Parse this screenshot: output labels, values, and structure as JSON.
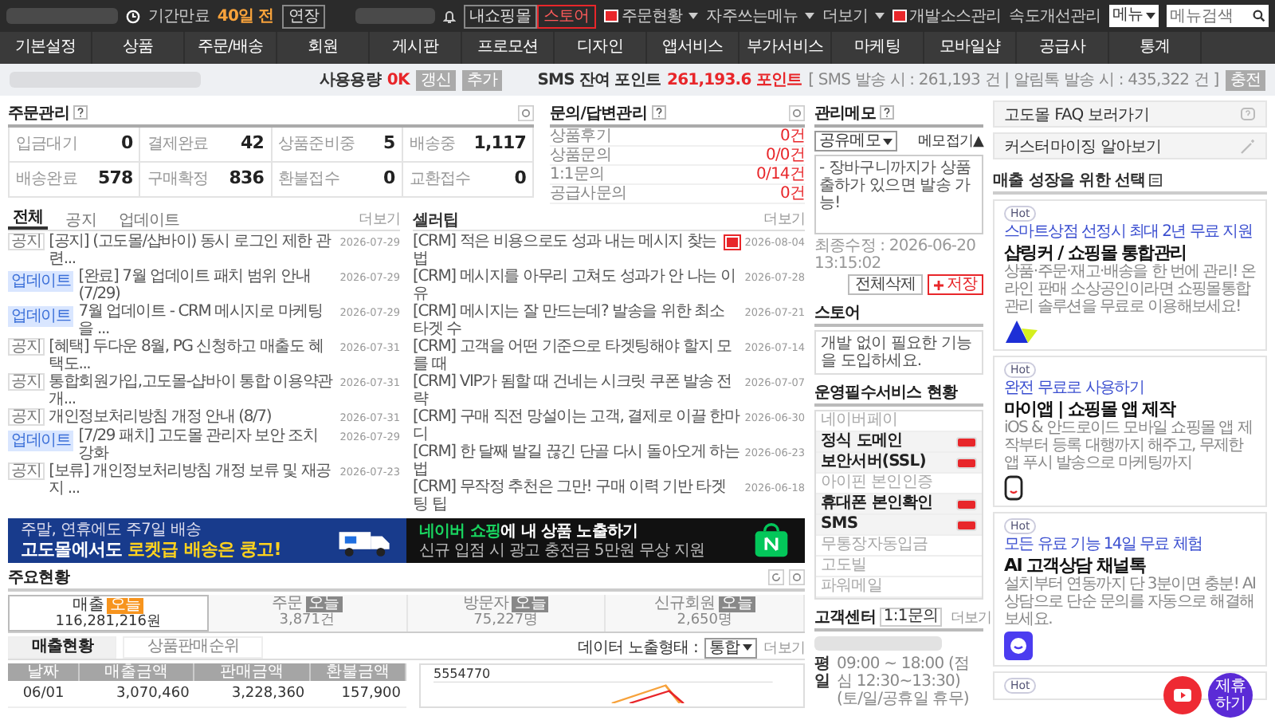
{
  "topbar": {
    "expiry_label": "기간만료",
    "expiry_days": "40일 전",
    "extend_button": "연장",
    "mall_button": "내쇼핑몰",
    "store_button": "스토어",
    "links": [
      {
        "label": "주문현황",
        "red_icon": true,
        "dropdown": true
      },
      {
        "label": "자주쓰는메뉴",
        "red_icon": false,
        "dropdown": true
      },
      {
        "label": "더보기",
        "red_icon": false,
        "dropdown": true
      },
      {
        "label": "개발소스관리",
        "red_icon": true,
        "dropdown": false
      },
      {
        "label": "속도개선관리",
        "red_icon": false,
        "dropdown": false
      }
    ],
    "menu_select": "메뉴",
    "search_placeholder": "메뉴검색"
  },
  "nav": [
    "기본설정",
    "상품",
    "주문/배송",
    "회원",
    "게시판",
    "프로모션",
    "디자인",
    "앱서비스",
    "부가서비스",
    "마케팅",
    "모바일샵",
    "공급사",
    "통계"
  ],
  "status_strip": {
    "usage_label": "사용용량",
    "usage_value": "0K",
    "usage_buttons": [
      "갱신",
      "추가"
    ],
    "sms_label": "SMS 잔여 포인트",
    "sms_value": "261,193.6 포인트",
    "sms_detail": "[ SMS 발송 시 : 261,193 건 | 알림톡 발송 시 : 435,322 건 ]",
    "charge_button": "충전"
  },
  "orders": {
    "title": "주문관리",
    "cells": [
      {
        "label": "입금대기",
        "value": "0"
      },
      {
        "label": "결제완료",
        "value": "42"
      },
      {
        "label": "상품준비중",
        "value": "5"
      },
      {
        "label": "배송중",
        "value": "1,117"
      },
      {
        "label": "배송완료",
        "value": "578"
      },
      {
        "label": "구매확정",
        "value": "836"
      },
      {
        "label": "환불접수",
        "value": "0"
      },
      {
        "label": "교환접수",
        "value": "0"
      }
    ]
  },
  "inquiries": {
    "title": "문의/답변관리",
    "rows": [
      {
        "label": "상품후기",
        "value": "0건"
      },
      {
        "label": "상품문의",
        "value": "0/0건"
      },
      {
        "label": "1:1문의",
        "value": "0/14건"
      },
      {
        "label": "공급사문의",
        "value": "0건"
      }
    ]
  },
  "notices": {
    "tabs": [
      {
        "label": "전체",
        "selected": true
      },
      {
        "label": "공지",
        "selected": false
      },
      {
        "label": "업데이트",
        "selected": false
      }
    ],
    "more": "더보기",
    "items": [
      {
        "kind": "notice",
        "tag": "공지",
        "title": "[공지] (고도몰/샵바이) 동시 로그인 제한 관련...",
        "date": "2026-07-29"
      },
      {
        "kind": "update",
        "tag": "업데이트",
        "title": "[완료] 7월 업데이트 패치 범위 안내 (7/29)",
        "date": "2026-07-29"
      },
      {
        "kind": "update",
        "tag": "업데이트",
        "title": "7월 업데이트 - CRM 메시지로 마케팅을 ...",
        "date": "2026-07-29"
      },
      {
        "kind": "notice",
        "tag": "공지",
        "title": "[혜택] 두다운 8월, PG 신청하고 매출도 혜택도...",
        "date": "2026-07-31"
      },
      {
        "kind": "notice",
        "tag": "공지",
        "title": "통합회원가입,고도몰-샵바이 통합 이용약관 개...",
        "date": "2026-07-31"
      },
      {
        "kind": "notice",
        "tag": "공지",
        "title": "개인정보처리방침 개정 안내 (8/7)",
        "date": "2026-07-31"
      },
      {
        "kind": "update",
        "tag": "업데이트",
        "title": "[7/29 패치] 고도몰 관리자 보안 조치 강화",
        "date": "2026-07-29"
      },
      {
        "kind": "notice",
        "tag": "공지",
        "title": "[보류] 개인정보처리방침 개정 보류 및 재공지 ...",
        "date": "2026-07-23"
      }
    ]
  },
  "tips": {
    "title": "셀러팁",
    "more": "더보기",
    "items": [
      {
        "title": "[CRM] 적은 비용으로도 성과 내는 메시지 찾는 법",
        "date": "2026-08-04",
        "new": true
      },
      {
        "title": "[CRM] 메시지를 아무리 고쳐도 성과가 안 나는 이유",
        "date": "2026-07-28",
        "new": false
      },
      {
        "title": "[CRM] 메시지는 잘 만드는데? 발송을 위한 최소 타겟 수",
        "date": "2026-07-21",
        "new": false
      },
      {
        "title": "[CRM] 고객을 어떤 기준으로 타겟팅해야 할지 모를 때",
        "date": "2026-07-14",
        "new": false
      },
      {
        "title": "[CRM] VIP가 됨할 때 건네는 시크릿 쿠폰 발송 전략",
        "date": "2026-07-07",
        "new": false
      },
      {
        "title": "[CRM] 구매 직전 망설이는 고객, 결제로 이끌 한마디",
        "date": "2026-06-30",
        "new": false
      },
      {
        "title": "[CRM] 한 달째 발길 끊긴 단골 다시 돌아오게 하는 법",
        "date": "2026-06-23",
        "new": false
      },
      {
        "title": "[CRM] 무작정 추천은 그만! 구매 이력 기반 타겟팅 팁",
        "date": "2026-06-18",
        "new": false
      }
    ]
  },
  "banners": [
    {
      "kind": "delivery",
      "line1": "주말, 연휴에도 주7일 배송",
      "title_plain": "고도몰에서도",
      "title_highlight": "로켓급 배송은 쿵고!"
    },
    {
      "kind": "naver",
      "title_highlight": "네이버 쇼핑",
      "title_plain": "에 내 상품 노출하기",
      "line2": "신규 입점 시 광고 충전금 5만원 무상 지원"
    }
  ],
  "summary": {
    "title": "주요현황",
    "stats": [
      {
        "label": "매출",
        "badge": "오늘",
        "value": "116,281,216원",
        "selected": true
      },
      {
        "label": "주문",
        "badge": "오늘",
        "value": "3,871건",
        "selected": false
      },
      {
        "label": "방문자",
        "badge": "오늘",
        "value": "75,227명",
        "selected": false
      },
      {
        "label": "신규회원",
        "badge": "오늘",
        "value": "2,650명",
        "selected": false
      }
    ],
    "tabs": [
      {
        "label": "매출현황",
        "selected": true
      },
      {
        "label": "상품판매순위",
        "selected": false
      }
    ],
    "display_label": "데이터 노출형태 :",
    "display_select": "통합",
    "more": "더보기",
    "table": {
      "columns": [
        "날짜",
        "매출금액",
        "판매금액",
        "환불금액"
      ],
      "rows": [
        [
          "06/01",
          "3,070,460",
          "3,228,360",
          "157,900"
        ]
      ]
    },
    "chart_label": "5554770"
  },
  "memo": {
    "title": "관리메모",
    "share_select": "공유메모",
    "collapse": "메모접기▲",
    "text": "- 장바구니까지가 상품출하가 있으면 발송 가능!",
    "updated": "최종수정 : 2026-06-20 13:15:02",
    "delete_button": "전체삭제",
    "save_button": "저장"
  },
  "store": {
    "title": "스토어",
    "text": "개발 없이 필요한 기능을 도입하세요."
  },
  "services": {
    "title": "운영필수서비스 현황",
    "items": [
      {
        "label": "네이버페이",
        "on": false
      },
      {
        "label": "정식 도메인",
        "on": true
      },
      {
        "label": "보안서버(SSL)",
        "on": true
      },
      {
        "label": "아이핀 본인인증",
        "on": false
      },
      {
        "label": "휴대폰 본인확인",
        "on": true
      },
      {
        "label": "SMS",
        "on": true
      },
      {
        "label": "무통장자동입금",
        "on": false
      },
      {
        "label": "고도빌",
        "on": false
      },
      {
        "label": "파워메일",
        "on": false
      }
    ]
  },
  "support": {
    "title": "고객센터",
    "badge": "1:1문의",
    "more": "더보기",
    "hours_label": "평일",
    "hours": "09:00 ~ 18:00 (점심 12:30~13:30)",
    "closed": "(토/일/공휴일 휴무)"
  },
  "side_links": [
    {
      "kind": "faq",
      "label": "고도몰 FAQ 보러가기"
    },
    {
      "kind": "custom",
      "label": "커스터마이징 알아보기"
    }
  ],
  "promo": {
    "title": "매출 성장을 위한 선택",
    "cards": [
      {
        "kind": "shoplinker",
        "badge": "Hot",
        "subtitle": "스마트상점 선정시 최대 2년 무료 지원",
        "title": "샵링커 / 쇼핑몰 통합관리",
        "text": "상품·주문·재고·배송을 한 번에 관리! 온라인 판매 소상공인이라면 쇼핑몰통합관리 솔루션을 무료로 이용해보세요!"
      },
      {
        "kind": "myapp",
        "badge": "Hot",
        "subtitle": "완전 무료로 사용하기",
        "title": "마이앱 | 쇼핑몰 앱 제작",
        "text": "iOS & 안드로이드 모바일 쇼핑몰 앱 제작부터 등록 대행까지 해주고, 무제한 앱 푸시 발송으로 마케팅까지"
      },
      {
        "kind": "channeltalk",
        "badge": "Hot",
        "subtitle": "모든 유료 기능 14일 무료 체험",
        "title": "AI 고객상담 채널톡",
        "text": "설치부터 연동까지 단 3분이면 충분! AI 상담으로 단순 문의를 자동으로 해결해 보세요."
      },
      {
        "kind": "more",
        "badge": "Hot"
      }
    ]
  },
  "floating": {
    "action_label": "제휴하기"
  }
}
